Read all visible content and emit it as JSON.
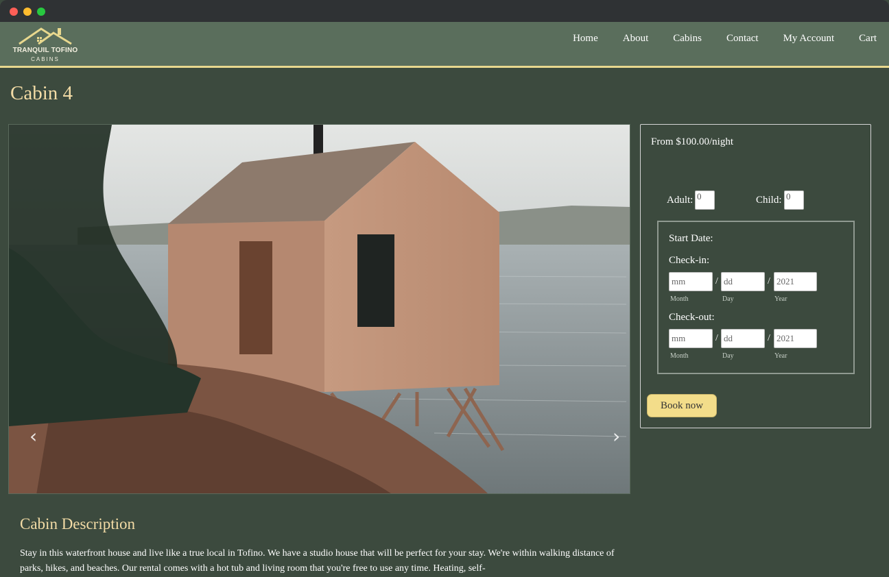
{
  "window": {
    "traffic_lights": [
      "close",
      "minimize",
      "maximize"
    ]
  },
  "brand": {
    "line1": "TRANQUIL TOFINO",
    "line2": "CABINS",
    "icon": "house-roof-logo"
  },
  "nav": {
    "items": [
      "Home",
      "About",
      "Cabins",
      "Contact",
      "My Account",
      "Cart"
    ]
  },
  "page": {
    "title": "Cabin 4"
  },
  "carousel": {
    "prev_icon": "‹",
    "next_icon": "›"
  },
  "booking": {
    "price": "From $100.00/night",
    "adult_label": "Adult:",
    "adult_value": "0",
    "child_label": "Child:",
    "child_value": "0",
    "start_date_label": "Start Date:",
    "checkin": {
      "label": "Check-in:",
      "month": "mm",
      "day": "dd",
      "year": "2021"
    },
    "checkout": {
      "label": "Check-out:",
      "month": "mm",
      "day": "dd",
      "year": "2021"
    },
    "hints": {
      "month": "Month",
      "day": "Day",
      "year": "Year"
    },
    "slash": "/",
    "button": "Book now"
  },
  "description": {
    "title": "Cabin Description",
    "text": "Stay in this waterfront house and live like a true local in Tofino. We have a studio house that will be perfect for your stay. We're within walking distance of parks, hikes, and beaches. Our rental comes with a hot tub and living room that you're free to use any time. Heating, self-"
  },
  "colors": {
    "nav_bg": "#5a6e5c",
    "page_bg": "#3c4a3e",
    "accent": "#f3dca6",
    "button": "#f3dd8a"
  }
}
